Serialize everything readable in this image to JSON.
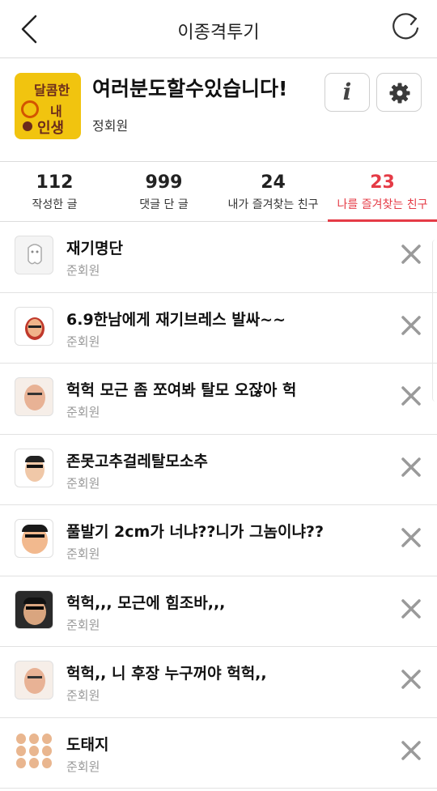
{
  "header": {
    "title": "이종격투기",
    "back_icon": "chevron-left-icon",
    "refresh_icon": "refresh-icon"
  },
  "profile": {
    "name": "여러분도할수있습니다!",
    "rank": "정회원",
    "avatar_text": [
      "달콤한",
      "내",
      "인생"
    ],
    "info_label": "i",
    "accent": "#f1c40f"
  },
  "stats": [
    {
      "num": "112",
      "label": "작성한 글"
    },
    {
      "num": "999",
      "label": "댓글 단 글"
    },
    {
      "num": "24",
      "label": "내가 즐겨찾는 친구"
    },
    {
      "num": "23",
      "label": "나를 즐겨찾는 친구"
    }
  ],
  "active_color": "#e53b46",
  "friends": [
    {
      "title": "재기명단",
      "rank": "준회원"
    },
    {
      "title": "6.9한남에게 재기브레스 발싸~~",
      "rank": "준회원"
    },
    {
      "title": "헉헉 모근 좀 쪼여봐 탈모 오잖아 헉",
      "rank": "준회원"
    },
    {
      "title": "존못고추걸레탈모소추",
      "rank": "준회원"
    },
    {
      "title": "풀발기 2cm가 너냐??니가 그놈이냐??",
      "rank": "준회원"
    },
    {
      "title": "헉헉,,, 모근에 힘조바,,,",
      "rank": "준회원"
    },
    {
      "title": "헉헉,, 니 후장 누구꺼야 헉헉,,",
      "rank": "준회원"
    },
    {
      "title": "도태지",
      "rank": "준회원"
    }
  ]
}
